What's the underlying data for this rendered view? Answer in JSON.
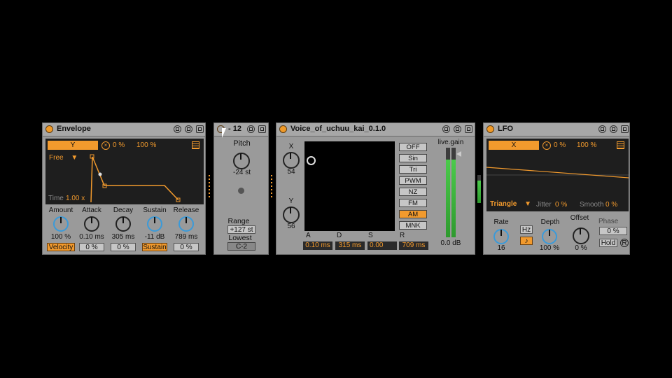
{
  "envelope": {
    "title": "Envelope",
    "target": "Y",
    "amount_pct": "0 %",
    "amount_max": "100 %",
    "mode": "Free",
    "time_label": "Time",
    "time_value": "1.00 x",
    "knobs": [
      {
        "label": "Amount",
        "value": "100 %",
        "field": "Velocity"
      },
      {
        "label": "Attack",
        "value": "0.10 ms",
        "field": "0 %"
      },
      {
        "label": "Decay",
        "value": "305 ms",
        "field": "0 %"
      },
      {
        "label": "Sustain",
        "value": "-11 dB",
        "field": "Sustain"
      },
      {
        "label": "Release",
        "value": "789 ms",
        "field": "0 %"
      }
    ]
  },
  "pitch": {
    "title": "- 12",
    "pitch_label": "Pitch",
    "pitch_value": "-24 st",
    "range_label": "Range",
    "range_value": "+127 st",
    "lowest_label": "Lowest",
    "lowest_value": "C-2"
  },
  "voice": {
    "title": "Voice_of_uchuu_kai_0.1.0",
    "x_label": "X",
    "x_value": "54",
    "y_label": "Y",
    "y_value": "56",
    "modes": [
      "OFF",
      "Sin",
      "Tri",
      "PWM",
      "NZ",
      "FM",
      "AM",
      "MNK"
    ],
    "active_mode": "AM",
    "adsr": [
      {
        "label": "A",
        "value": "0.10 ms"
      },
      {
        "label": "D",
        "value": "315 ms"
      },
      {
        "label": "S",
        "value": "0.00"
      },
      {
        "label": "R",
        "value": "709 ms"
      }
    ],
    "gain_label": "live.gain",
    "gain_value": "0.0 dB"
  },
  "lfo": {
    "title": "LFO",
    "target": "X",
    "amount_pct": "0 %",
    "amount_max": "100 %",
    "waveform": "Triangle",
    "jitter_label": "Jitter",
    "jitter_value": "0 %",
    "smooth_label": "Smooth",
    "smooth_value": "0 %",
    "rate_label": "Rate",
    "rate_value": "16",
    "hz_label": "Hz",
    "sync_glyph": "♪",
    "depth_label": "Depth",
    "depth_value": "100 %",
    "offset_label": "Offset",
    "offset_value": "0 %",
    "phase_label": "Phase",
    "phase_value": "0 %",
    "hold_label": "Hold",
    "r_label": "R"
  },
  "colors": {
    "accent": "#f29a2d",
    "panel": "#9a9a9a",
    "screen": "#1e1e1e",
    "knob_ring": "#3a9ad9",
    "meter": "#4bcb4b"
  }
}
